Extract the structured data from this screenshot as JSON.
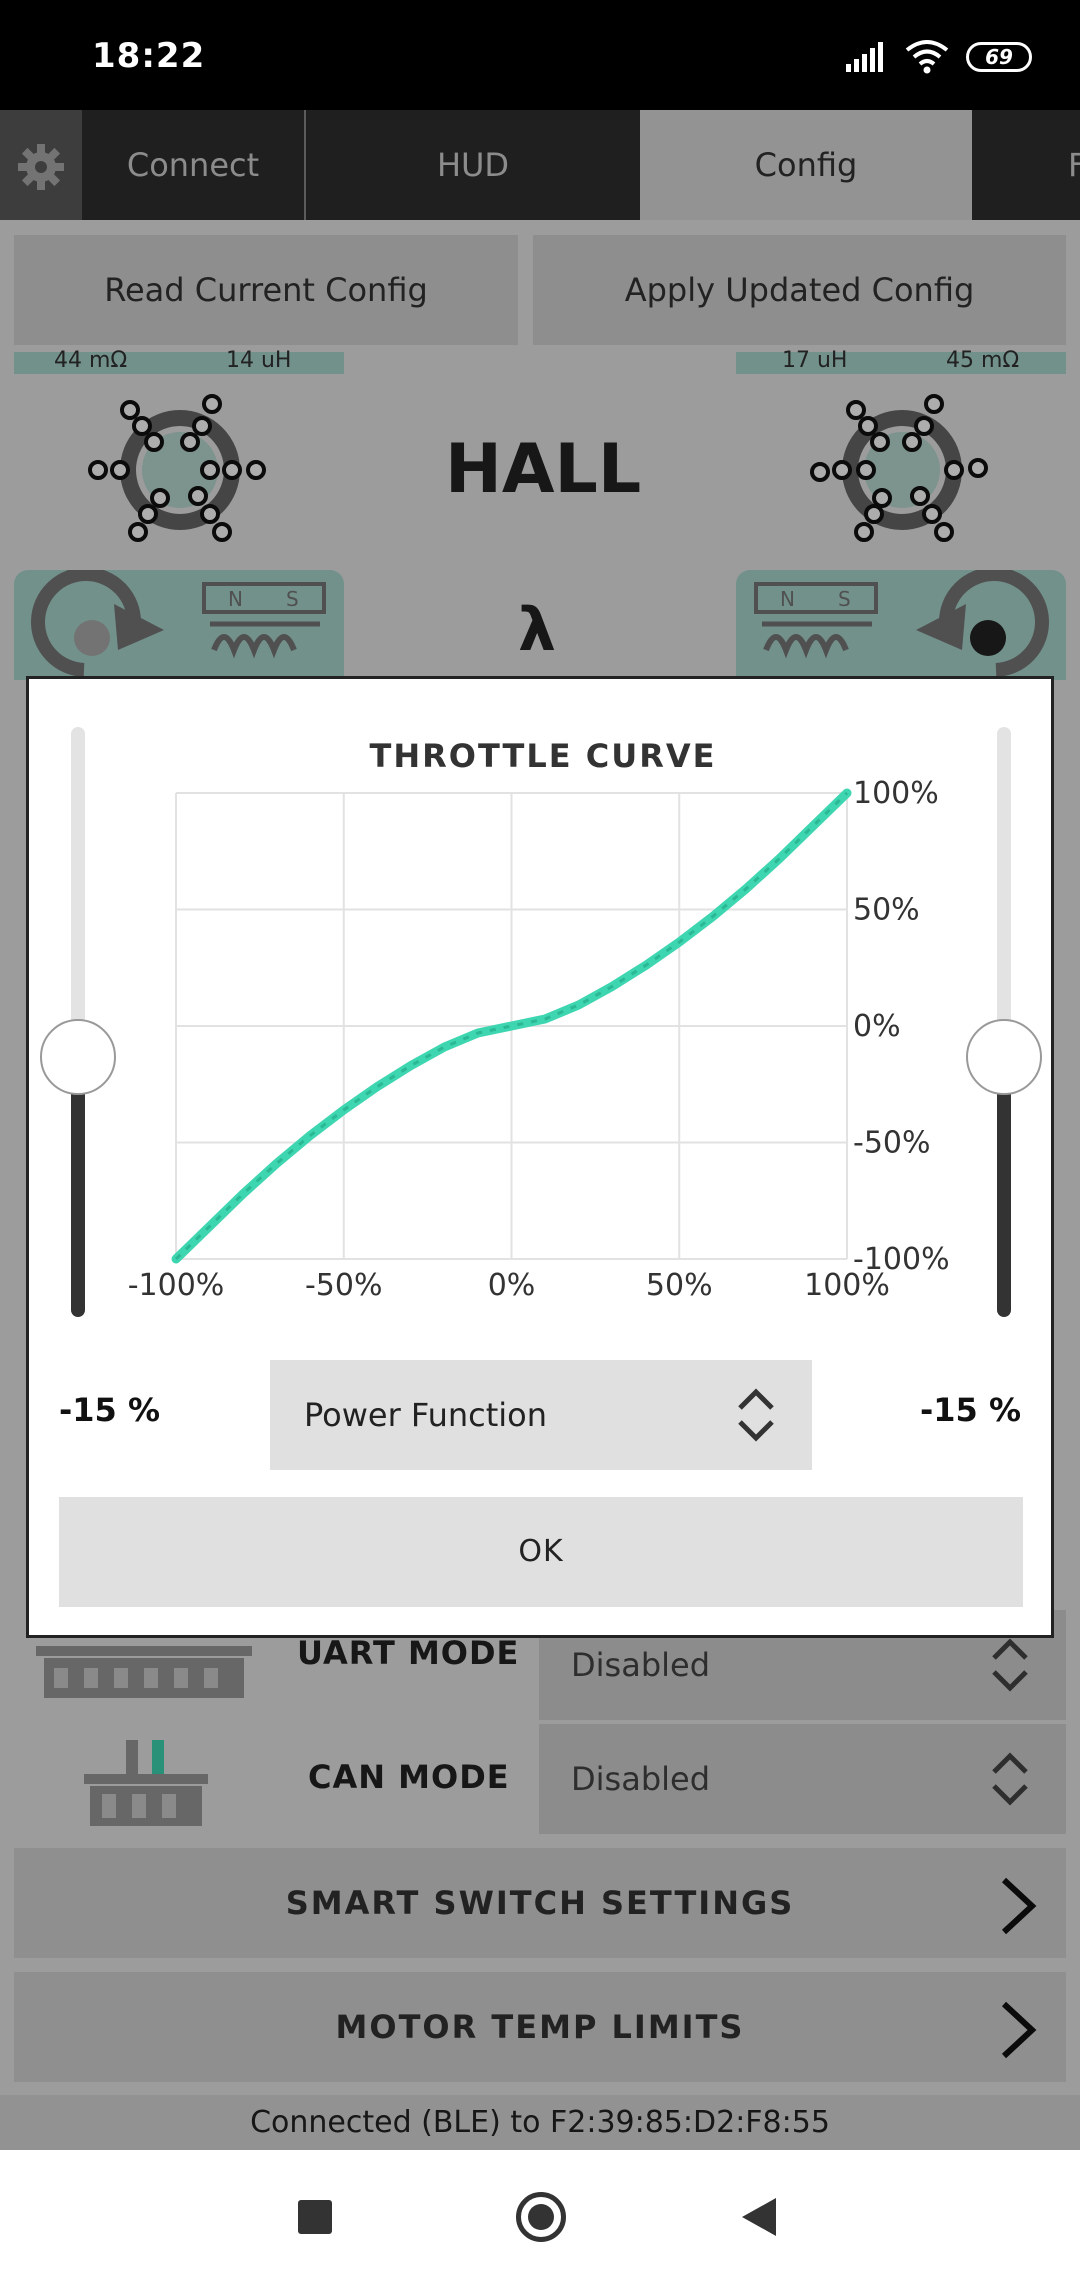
{
  "status_bar": {
    "time": "18:22",
    "battery": "69"
  },
  "tabs": [
    {
      "label": "Connect"
    },
    {
      "label": "HUD"
    },
    {
      "label": "Config"
    },
    {
      "label": "F"
    }
  ],
  "config_buttons": {
    "read": "Read Current Config",
    "apply": "Apply Updated Config"
  },
  "motor_left": {
    "resistance": "44 mΩ",
    "inductance": "14 uH"
  },
  "motor_right": {
    "inductance": "17 uH",
    "resistance": "45 mΩ"
  },
  "sensor_mode": "HALL",
  "lambda_symbol": "λ",
  "magnet_labels": {
    "n": "N",
    "s": "S"
  },
  "uart": {
    "label": "UART MODE",
    "value": "Disabled"
  },
  "can": {
    "label": "CAN MODE",
    "value": "Disabled"
  },
  "smart_switch_label": "SMART SWITCH SETTINGS",
  "motor_temp_label": "MOTOR TEMP LIMITS",
  "connection_status": "Connected (BLE) to F2:39:85:D2:F8:55",
  "dialog": {
    "left_value": "-15 %",
    "right_value": "-15 %",
    "function": "Power Function",
    "ok_label": "OK"
  },
  "colors": {
    "curve": "#3dd6b0",
    "accent": "#a8d6cd"
  },
  "chart_data": {
    "type": "line",
    "title": "THROTTLE CURVE",
    "x_ticks": [
      "-100%",
      "-50%",
      "0%",
      "50%",
      "100%"
    ],
    "y_ticks": [
      "100%",
      "50%",
      "0%",
      "-50%",
      "-100%"
    ],
    "xlim": [
      -100,
      100
    ],
    "ylim": [
      -100,
      100
    ],
    "grid": true,
    "series": [
      {
        "x": [
          -100,
          -90,
          -80,
          -70,
          -60,
          -50,
          -40,
          -30,
          -20,
          -10,
          0,
          10,
          20,
          30,
          40,
          50,
          60,
          70,
          80,
          90,
          100
        ],
        "y": [
          -100,
          -86,
          -72,
          -59,
          -47,
          -36,
          -26,
          -17,
          -9,
          -3,
          0,
          3,
          9,
          17,
          26,
          36,
          47,
          59,
          72,
          86,
          100
        ]
      }
    ]
  }
}
